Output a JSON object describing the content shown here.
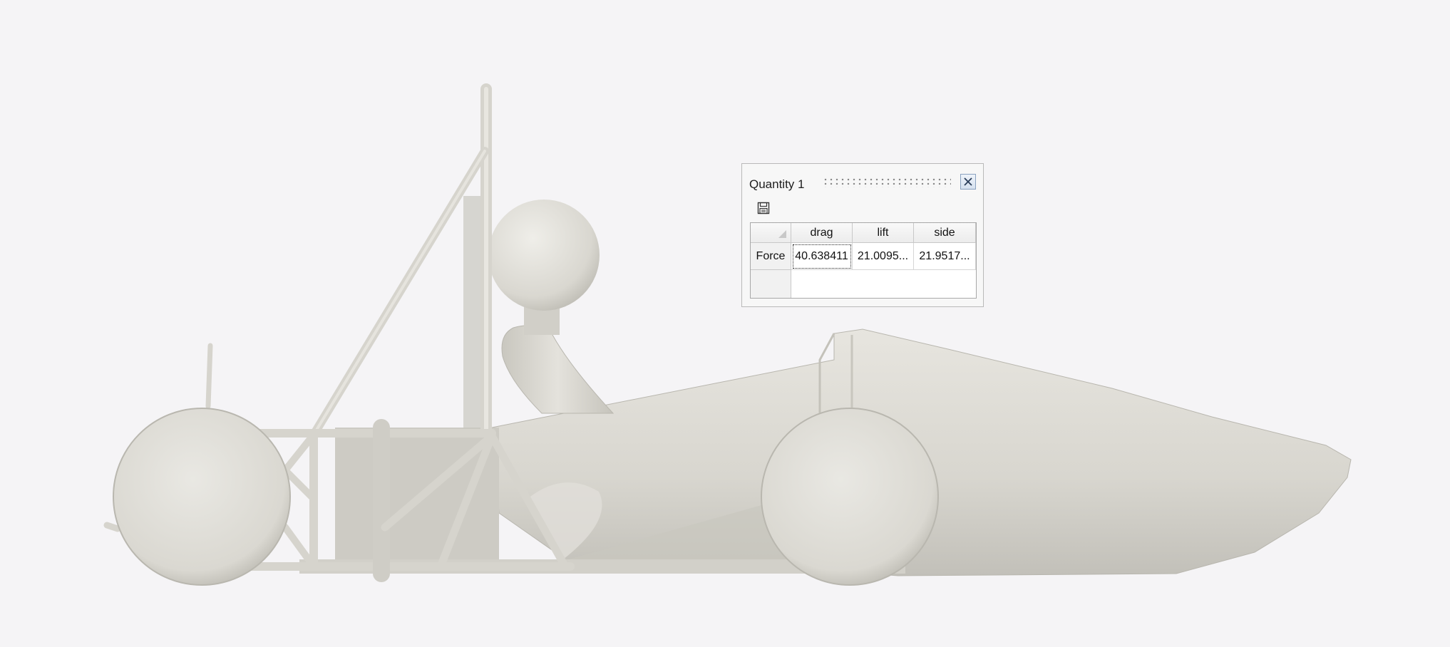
{
  "panel": {
    "title": "Quantity 1",
    "close_icon": "close-icon",
    "save_icon": "save-icon"
  },
  "table": {
    "columns": [
      "drag",
      "lift",
      "side"
    ],
    "rows": [
      {
        "label": "Force",
        "values": [
          "40.638411",
          "21.0095...",
          "21.9517..."
        ]
      }
    ],
    "selected_cell": "drag"
  },
  "colors": {
    "background": "#f5f4f6",
    "model": "#d9d7d0"
  }
}
